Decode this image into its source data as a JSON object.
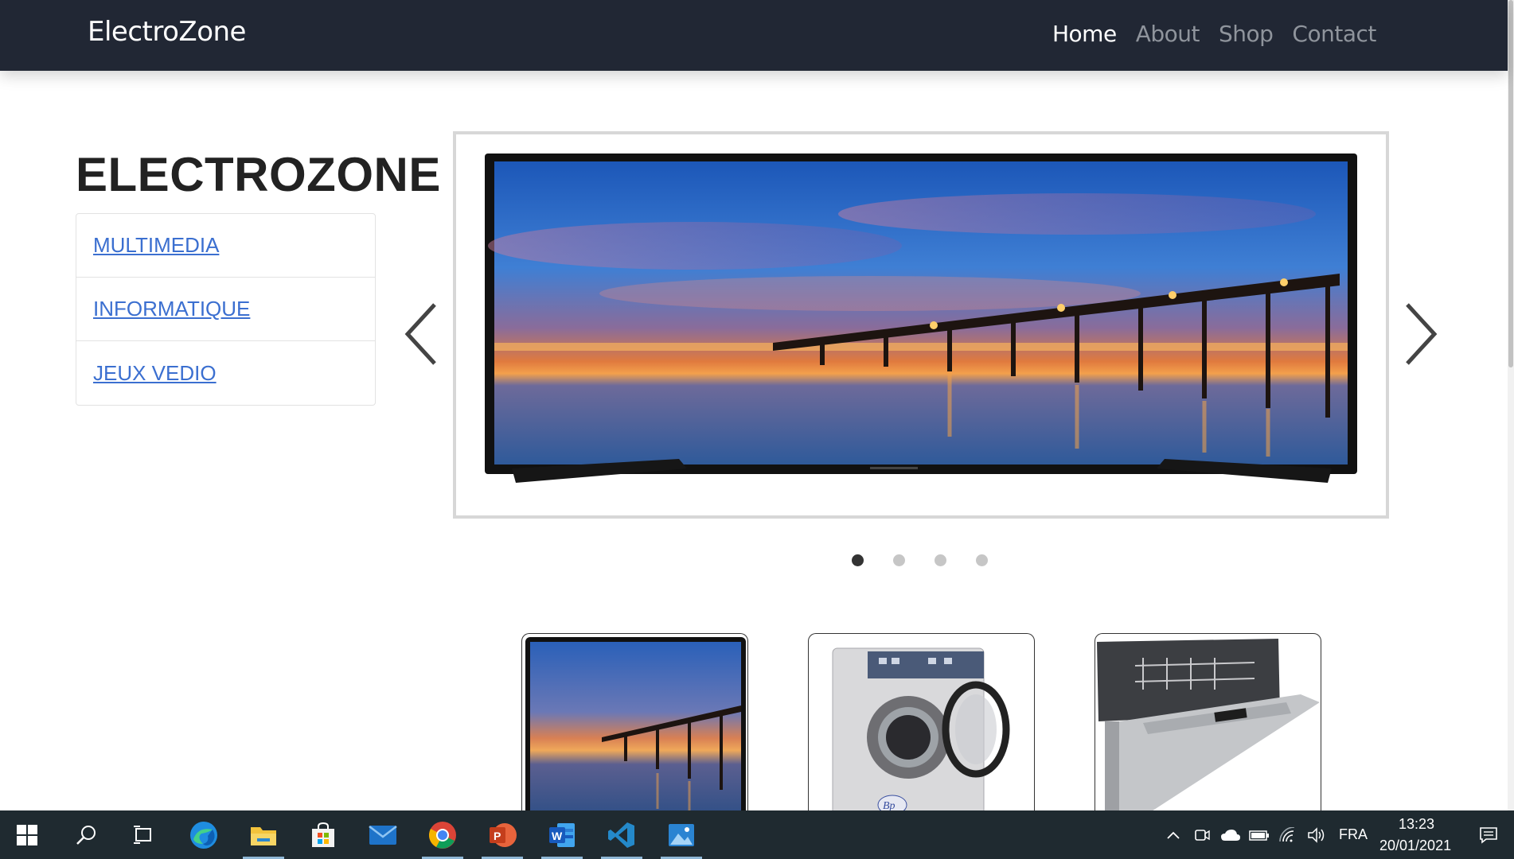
{
  "navbar": {
    "brand": "ElectroZone",
    "links": [
      {
        "label": "Home",
        "active": true
      },
      {
        "label": "About",
        "active": false
      },
      {
        "label": "Shop",
        "active": false
      },
      {
        "label": "Contact",
        "active": false
      }
    ]
  },
  "sidebar": {
    "title": "ELECTROZONE",
    "categories": [
      {
        "label": "MULTIMEDIA"
      },
      {
        "label": "INFORMATIQUE"
      },
      {
        "label": "JEUX VEDIO"
      }
    ]
  },
  "carousel": {
    "active_slide": 1,
    "slide_count": 4,
    "current_image": "tv-pier-sunset"
  },
  "products": [
    {
      "image": "laptop-pier-sunset"
    },
    {
      "image": "washing-machine"
    },
    {
      "image": "dishwasher"
    }
  ],
  "taskbar": {
    "apps": [
      "windows-start",
      "search",
      "task-view",
      "edge",
      "file-explorer",
      "microsoft-store",
      "mail",
      "chrome",
      "powerpoint",
      "word",
      "vscode",
      "photos"
    ],
    "language": "FRA",
    "time": "13:23",
    "date": "20/01/2021"
  },
  "colors": {
    "navbar_bg": "#212734",
    "link_blue": "#3b6fd0",
    "taskbar_bg": "#1f2a30"
  }
}
